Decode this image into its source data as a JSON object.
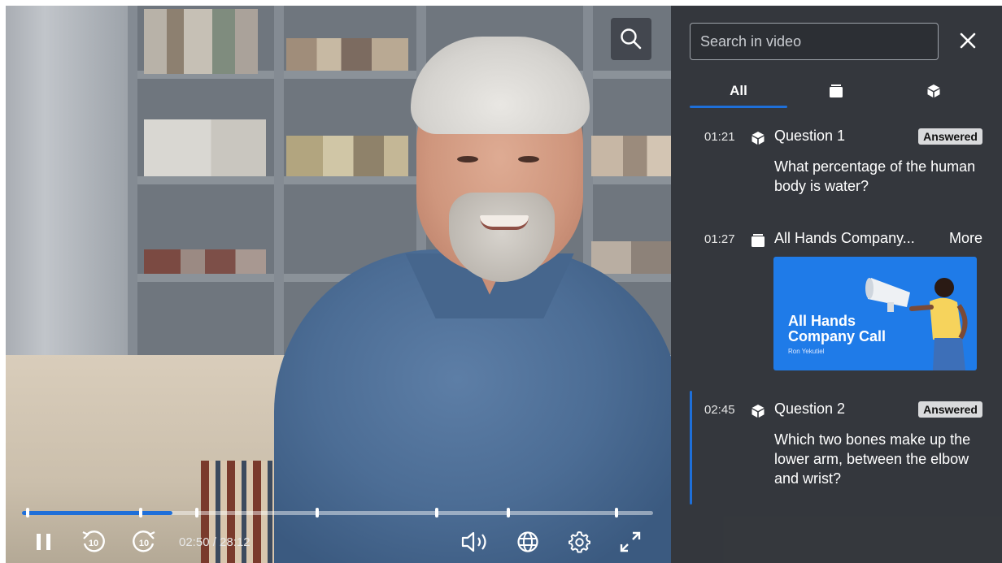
{
  "player": {
    "time_display": "02:50 / 28:12",
    "progress_fraction": 0.239
  },
  "icons": {
    "search": "search-icon",
    "pause": "pause-icon",
    "rewind": "rewind-10-icon",
    "forward": "forward-10-icon",
    "volume": "volume-icon",
    "language": "globe-icon",
    "settings": "gear-icon",
    "fullscreen": "fullscreen-icon",
    "close": "close-icon",
    "slide": "slide-icon",
    "quiz": "quiz-cube-icon"
  },
  "panel": {
    "search_placeholder": "Search in video",
    "tabs": [
      {
        "label": "All",
        "active": true
      },
      {
        "label": "",
        "icon": "slide-icon"
      },
      {
        "label": "",
        "icon": "quiz-cube-icon"
      }
    ],
    "items": [
      {
        "time": "01:21",
        "type": "quiz",
        "title": "Question 1",
        "badge": "Answered",
        "body": "What percentage of the human body is water?"
      },
      {
        "time": "01:27",
        "type": "slide",
        "title": "All Hands Company...",
        "link": "More",
        "slide_title": "All Hands Company Call",
        "slide_subtitle": "Ron Yekutiel"
      },
      {
        "time": "02:45",
        "type": "quiz",
        "title": "Question 2",
        "badge": "Answered",
        "body": "Which two bones make up the lower arm, between the elbow and wrist?",
        "current": true
      }
    ]
  },
  "colors": {
    "accent": "#1e6fd9",
    "panel_bg": "#34373c",
    "slide_bg": "#1f7be8"
  }
}
